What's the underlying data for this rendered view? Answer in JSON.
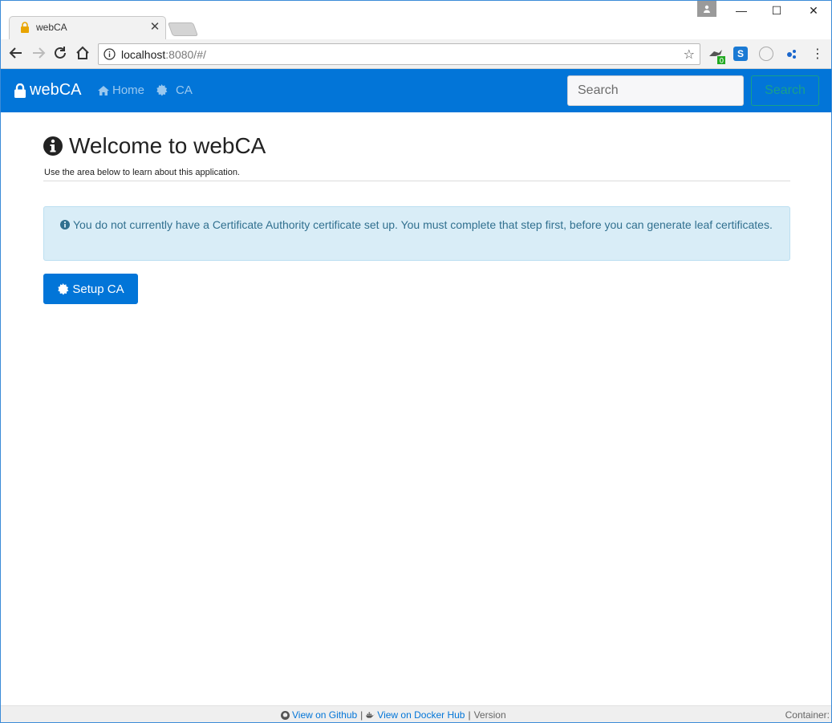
{
  "browser": {
    "tab_title": "webCA",
    "tab_close": "✕",
    "url_host": "localhost",
    "url_rest": ":8080/#/",
    "window_min": "—",
    "window_max": "☐",
    "window_close": "✕",
    "extension_badge": "0",
    "extension_s": "S"
  },
  "navbar": {
    "brand": "webCA",
    "links": [
      {
        "label": "Home",
        "icon": "home-icon"
      },
      {
        "label": "CA",
        "icon": "certificate-icon"
      }
    ],
    "search_placeholder": "Search",
    "search_button": "Search",
    "bg_color": "#0275d8"
  },
  "main": {
    "title": "Welcome to webCA",
    "subtitle": "Use the area below to learn about this application.",
    "alert_text": "You do not currently have a Certificate Authority certificate set up. You must complete that step first, before you can generate leaf certificates.",
    "setup_button": "Setup CA"
  },
  "footer": {
    "github_link": "View on Github",
    "docker_link": "View on Docker Hub",
    "separator": "|",
    "version_label": "Version",
    "container_label": "Container:"
  }
}
